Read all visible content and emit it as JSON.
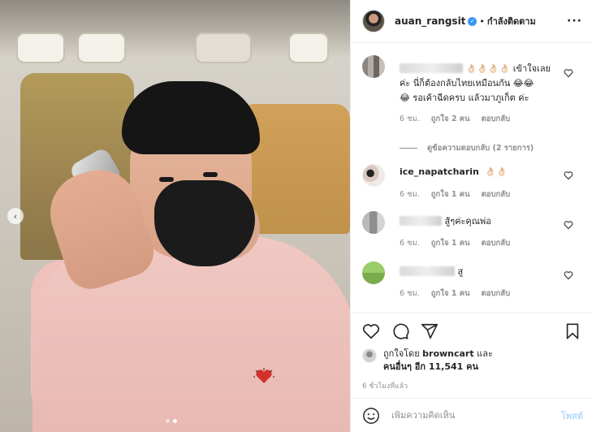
{
  "header": {
    "username": "auan_rangsit",
    "verified_icon": "verified-badge-icon",
    "separator": "•",
    "follow_status": "กำลังติดตาม",
    "more_icon": "more-options-icon"
  },
  "comments": [
    {
      "username_hidden": true,
      "text_line1": "👌🏻👌🏻👌🏻👌🏻 เข้าใจเลย",
      "text_line2": "ค่ะ นี่ก็ต้องกลับไทยเหมือนกัน 😂😂",
      "text_line3": "😂 รอเค้าฉีดครบ แล้วมาภูเก็ต ค่ะ",
      "time": "6 ชม.",
      "likes": "ถูกใจ 2 คน",
      "reply": "ตอบกลับ",
      "view_replies": "ดูข้อความตอบกลับ (2 รายการ)"
    },
    {
      "username": "ice_napatcharin",
      "text": "👌🏻👌🏻",
      "time": "6 ชม.",
      "likes": "ถูกใจ 1 คน",
      "reply": "ตอบกลับ"
    },
    {
      "username_hidden": true,
      "text": "สู้ๆค่ะคุณพ่อ",
      "time": "6 ชม.",
      "likes": "ถูกใจ 1 คน",
      "reply": "ตอบกลับ"
    },
    {
      "username_hidden": true,
      "text": "สู",
      "time": "6 ชม.",
      "likes": "ถูกใจ 1 คน",
      "reply": "ตอบกลับ"
    }
  ],
  "actions": {
    "like_icon": "heart-icon",
    "comment_icon": "comment-icon",
    "share_icon": "share-icon",
    "save_icon": "bookmark-icon"
  },
  "likes": {
    "prefix": "ถูกใจโดย",
    "first_liker": "browncart",
    "joiner": "และ",
    "others": "คนอื่นๆ อีก 11,541 คน"
  },
  "post_time": "6 ชั่วโมงที่แล้ว",
  "add_comment": {
    "placeholder": "เพิ่มความคิดเห็น",
    "post_label": "โพสต์",
    "emoji_icon": "emoji-icon"
  },
  "carousel": {
    "prev_icon": "chevron-left-icon",
    "slide_count": 2,
    "current_slide": 2
  },
  "colors": {
    "link_blue": "#3897f0",
    "post_disabled": "#b3dbff",
    "muted_text": "#8e8e8e",
    "shirt_pink": "#f0c8c2"
  }
}
